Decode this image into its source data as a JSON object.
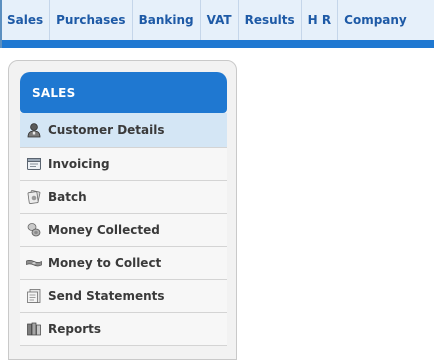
{
  "topnav": {
    "tabs": [
      {
        "label": "Sales"
      },
      {
        "label": "Purchases"
      },
      {
        "label": "Banking"
      },
      {
        "label": "VAT"
      },
      {
        "label": "Results"
      },
      {
        "label": "H R"
      },
      {
        "label": "Company"
      }
    ]
  },
  "sidebar": {
    "header": "SALES",
    "items": [
      {
        "label": "Customer Details",
        "icon": "person-icon",
        "active": true
      },
      {
        "label": "Invoicing",
        "icon": "invoice-icon",
        "active": false
      },
      {
        "label": "Batch",
        "icon": "batch-icon",
        "active": false
      },
      {
        "label": "Money Collected",
        "icon": "coins-icon",
        "active": false
      },
      {
        "label": "Money to Collect",
        "icon": "banknote-icon",
        "active": false
      },
      {
        "label": "Send Statements",
        "icon": "statement-icon",
        "active": false
      },
      {
        "label": "Reports",
        "icon": "reports-icon",
        "active": false
      }
    ]
  },
  "colors": {
    "accent": "#1f78d1",
    "nav_text": "#1e5aa6",
    "active_row": "#d4e6f5"
  }
}
